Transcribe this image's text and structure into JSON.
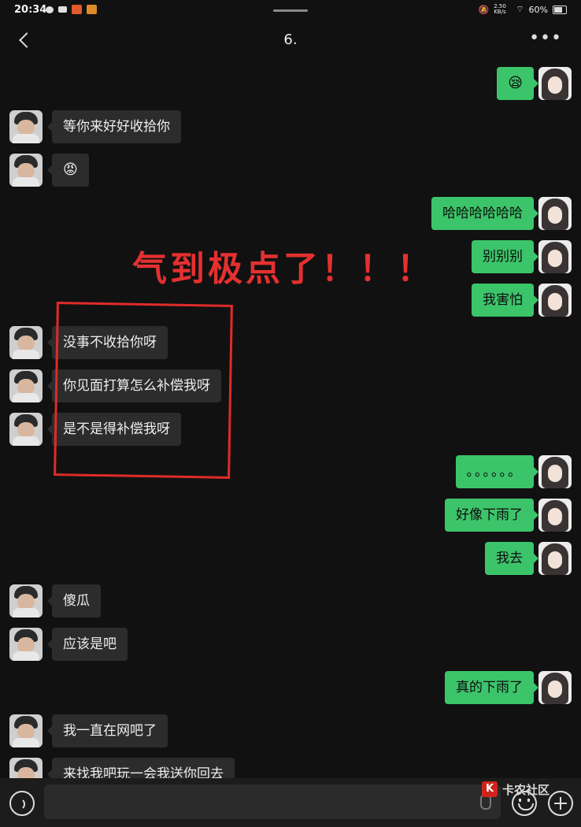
{
  "status": {
    "time": "20:34",
    "net": "2.50 KB/s",
    "battery": "60%"
  },
  "chat": {
    "title": "6.",
    "more": "•••"
  },
  "messages": {
    "m1": "😪",
    "m2": "等你来好好收拾你",
    "m3": "😡",
    "m4": "哈哈哈哈哈哈",
    "m5": "别别别",
    "m6": "我害怕",
    "m7": "没事不收拾你呀",
    "m8": "你见面打算怎么补偿我呀",
    "m9": "是不是得补偿我呀",
    "m10": "。。。。。。",
    "m11": "好像下雨了",
    "m12": "我去",
    "m13": "傻瓜",
    "m14": "应该是吧",
    "m15": "真的下雨了",
    "m16": "我一直在网吧了",
    "m17": "来找我吧玩一会我送你回去"
  },
  "annotation": {
    "text": "气到极点了！！！",
    "color": "#e53030"
  },
  "watermark": {
    "logo": "K",
    "text": "卡农社区"
  },
  "colors": {
    "background": "#111111",
    "outgoing": "#3cc46a",
    "incoming": "#2c2c2c",
    "mark": "#e02a2a"
  }
}
